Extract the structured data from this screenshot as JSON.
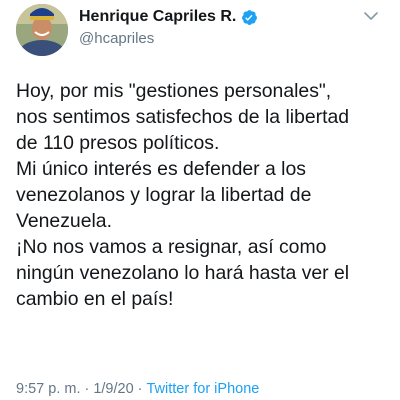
{
  "user": {
    "display_name": "Henrique Capriles R.",
    "handle": "@hcapriles",
    "verified": true,
    "avatar_icon": "profile-photo"
  },
  "header": {
    "menu_icon": "chevron-down-icon"
  },
  "tweet": {
    "lines": [
      "Hoy, por mis \"gestiones personales\",",
      "nos sentimos satisfechos de la libertad",
      "de 110 presos políticos.",
      "Mi único interés es defender a los",
      "venezolanos y lograr la libertad de",
      "Venezuela.",
      "¡No nos vamos a resignar, así como",
      "ningún venezolano lo hará hasta ver el",
      "cambio en el país!"
    ]
  },
  "meta": {
    "time": "9:57 p. m.",
    "separator1": "·",
    "date": "1/9/20",
    "separator2": "·",
    "source": "Twitter for iPhone"
  },
  "colors": {
    "text": "#14171a",
    "secondary": "#657786",
    "accent": "#1da1f2"
  }
}
